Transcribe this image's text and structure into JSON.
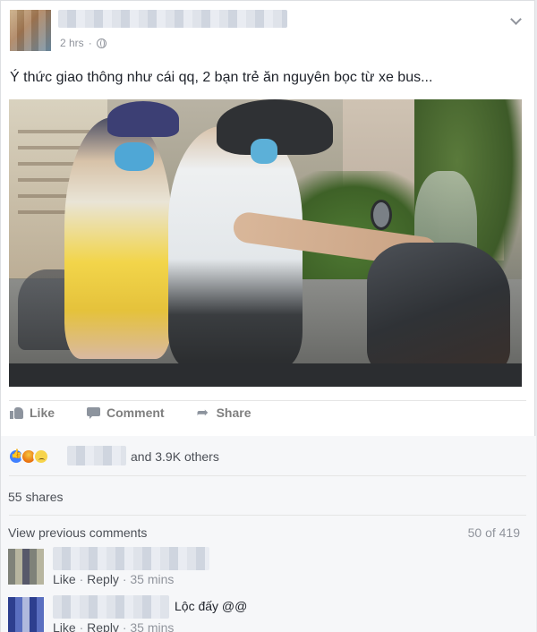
{
  "post": {
    "time": "2 hrs",
    "text": "Ý thức giao thông như cái qq, 2 bạn trẻ ăn nguyên bọc từ xe bus..."
  },
  "actions": {
    "like": "Like",
    "comment": "Comment",
    "share": "Share"
  },
  "reactions": {
    "icons": [
      "reaction-like-icon",
      "reaction-angry-icon",
      "reaction-sad-icon"
    ],
    "summary": "and 3.9K others"
  },
  "shares": "55 shares",
  "comments": {
    "view_previous": "View previous comments",
    "count": "50 of 419",
    "items": [
      {
        "text": "",
        "like": "Like",
        "reply": "Reply",
        "time": "35 mins"
      },
      {
        "text": "Lộc đấy @@",
        "like": "Like",
        "reply": "Reply",
        "time": "35 mins"
      }
    ]
  },
  "colors": {
    "background": "#e9ebee",
    "link": "#4b4f56",
    "muted": "#90949c",
    "like_blue": "#4080ff"
  }
}
